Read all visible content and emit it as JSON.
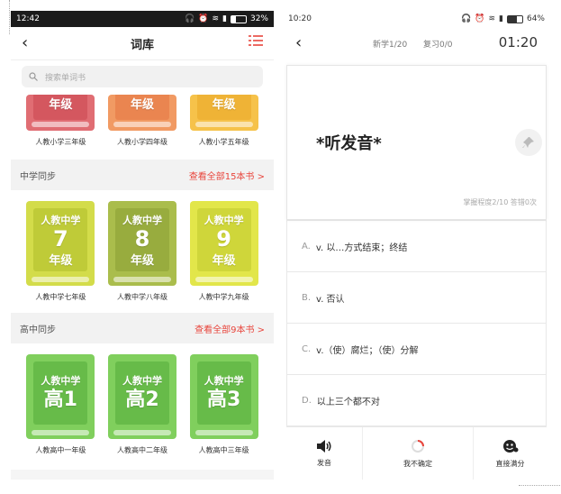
{
  "left": {
    "status": {
      "time": "12:42",
      "battery": "32%"
    },
    "nav": {
      "back": "‹",
      "title": "词库"
    },
    "search": {
      "placeholder": "搜索单词书"
    },
    "primary_books": [
      {
        "label": "人教小学三年级",
        "grade": "年级",
        "color": "#e8747a"
      },
      {
        "label": "人教小学四年级",
        "grade": "年级",
        "color": "#f39a62"
      },
      {
        "label": "人教小学五年级",
        "grade": "年级",
        "color": "#f6c24a"
      }
    ],
    "middle": {
      "title": "中学同步",
      "more": "查看全部15本书 >",
      "books": [
        {
          "publisher": "人教中学",
          "num": "7",
          "grade": "年级",
          "label": "人教中学七年级",
          "color": "#cbd64a",
          "inner": "#b6c63a"
        },
        {
          "publisher": "人教中学",
          "num": "8",
          "grade": "年级",
          "label": "人教中学八年级",
          "color": "#a8bb4a",
          "inner": "#96a93c"
        },
        {
          "publisher": "人教中学",
          "num": "9",
          "grade": "年级",
          "label": "人教中学九年级",
          "color": "#dde144",
          "inner": "#c8cf36"
        }
      ]
    },
    "high": {
      "title": "高中同步",
      "more": "查看全部9本书 >",
      "books": [
        {
          "publisher": "人教中学",
          "num": "高1",
          "label": "人教高中一年级",
          "color": "#7fcf5c",
          "inner": "#66bb48"
        },
        {
          "publisher": "人教中学",
          "num": "高2",
          "label": "人教高中二年级",
          "color": "#7fcf5c",
          "inner": "#66bb48"
        },
        {
          "publisher": "人教中学",
          "num": "高3",
          "label": "人教高中三年级",
          "color": "#7fcf5c",
          "inner": "#66bb48"
        }
      ]
    }
  },
  "right": {
    "status": {
      "time": "10:20",
      "battery": "64%"
    },
    "top": {
      "back": "‹",
      "progress": "新学1/20",
      "review": "复习0/0",
      "timer": "01:20"
    },
    "card": {
      "word": "*听发音*",
      "mastery": "掌握程度2/10  答错0次"
    },
    "options": [
      {
        "letter": "A.",
        "text": "v. 以…方式结束；终结"
      },
      {
        "letter": "B.",
        "text": "v. 否认"
      },
      {
        "letter": "C.",
        "text": "v.（使）腐烂；（使）分解"
      },
      {
        "letter": "D.",
        "text": "以上三个都不对"
      }
    ],
    "bottom": {
      "sound": "发音",
      "unsure": "我不确定",
      "full": "直接满分"
    }
  }
}
